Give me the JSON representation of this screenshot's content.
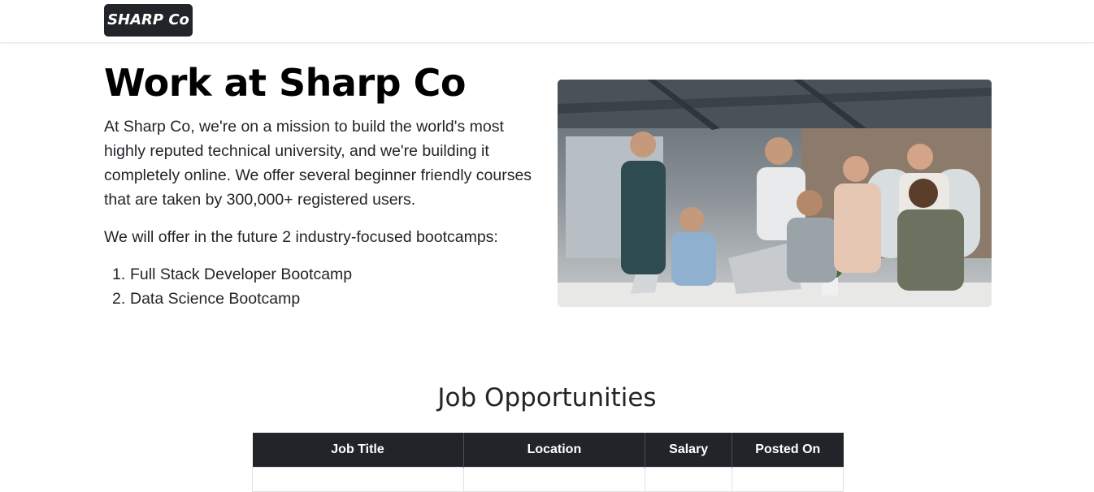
{
  "navbar": {
    "brand": "SHARP Co"
  },
  "hero": {
    "title": "Work at Sharp Co",
    "paragraph1": "At Sharp Co, we're on a mission to build the world's most highly reputed technical university, and we're building it completely online. We offer several beginner friendly courses that are taken by 300,000+ registered users.",
    "paragraph2": "We will offer in the future 2 industry-focused bootcamps:",
    "bootcamps": [
      {
        "num": "1.",
        "label": "Full Stack Developer Bootcamp"
      },
      {
        "num": "2.",
        "label": "Data Science Bootcamp"
      }
    ]
  },
  "jobs": {
    "title": "Job Opportunities",
    "columns": [
      "Job Title",
      "Location",
      "Salary",
      "Posted On"
    ]
  },
  "colors": {
    "dark": "#212529",
    "background": "#ffffff"
  }
}
